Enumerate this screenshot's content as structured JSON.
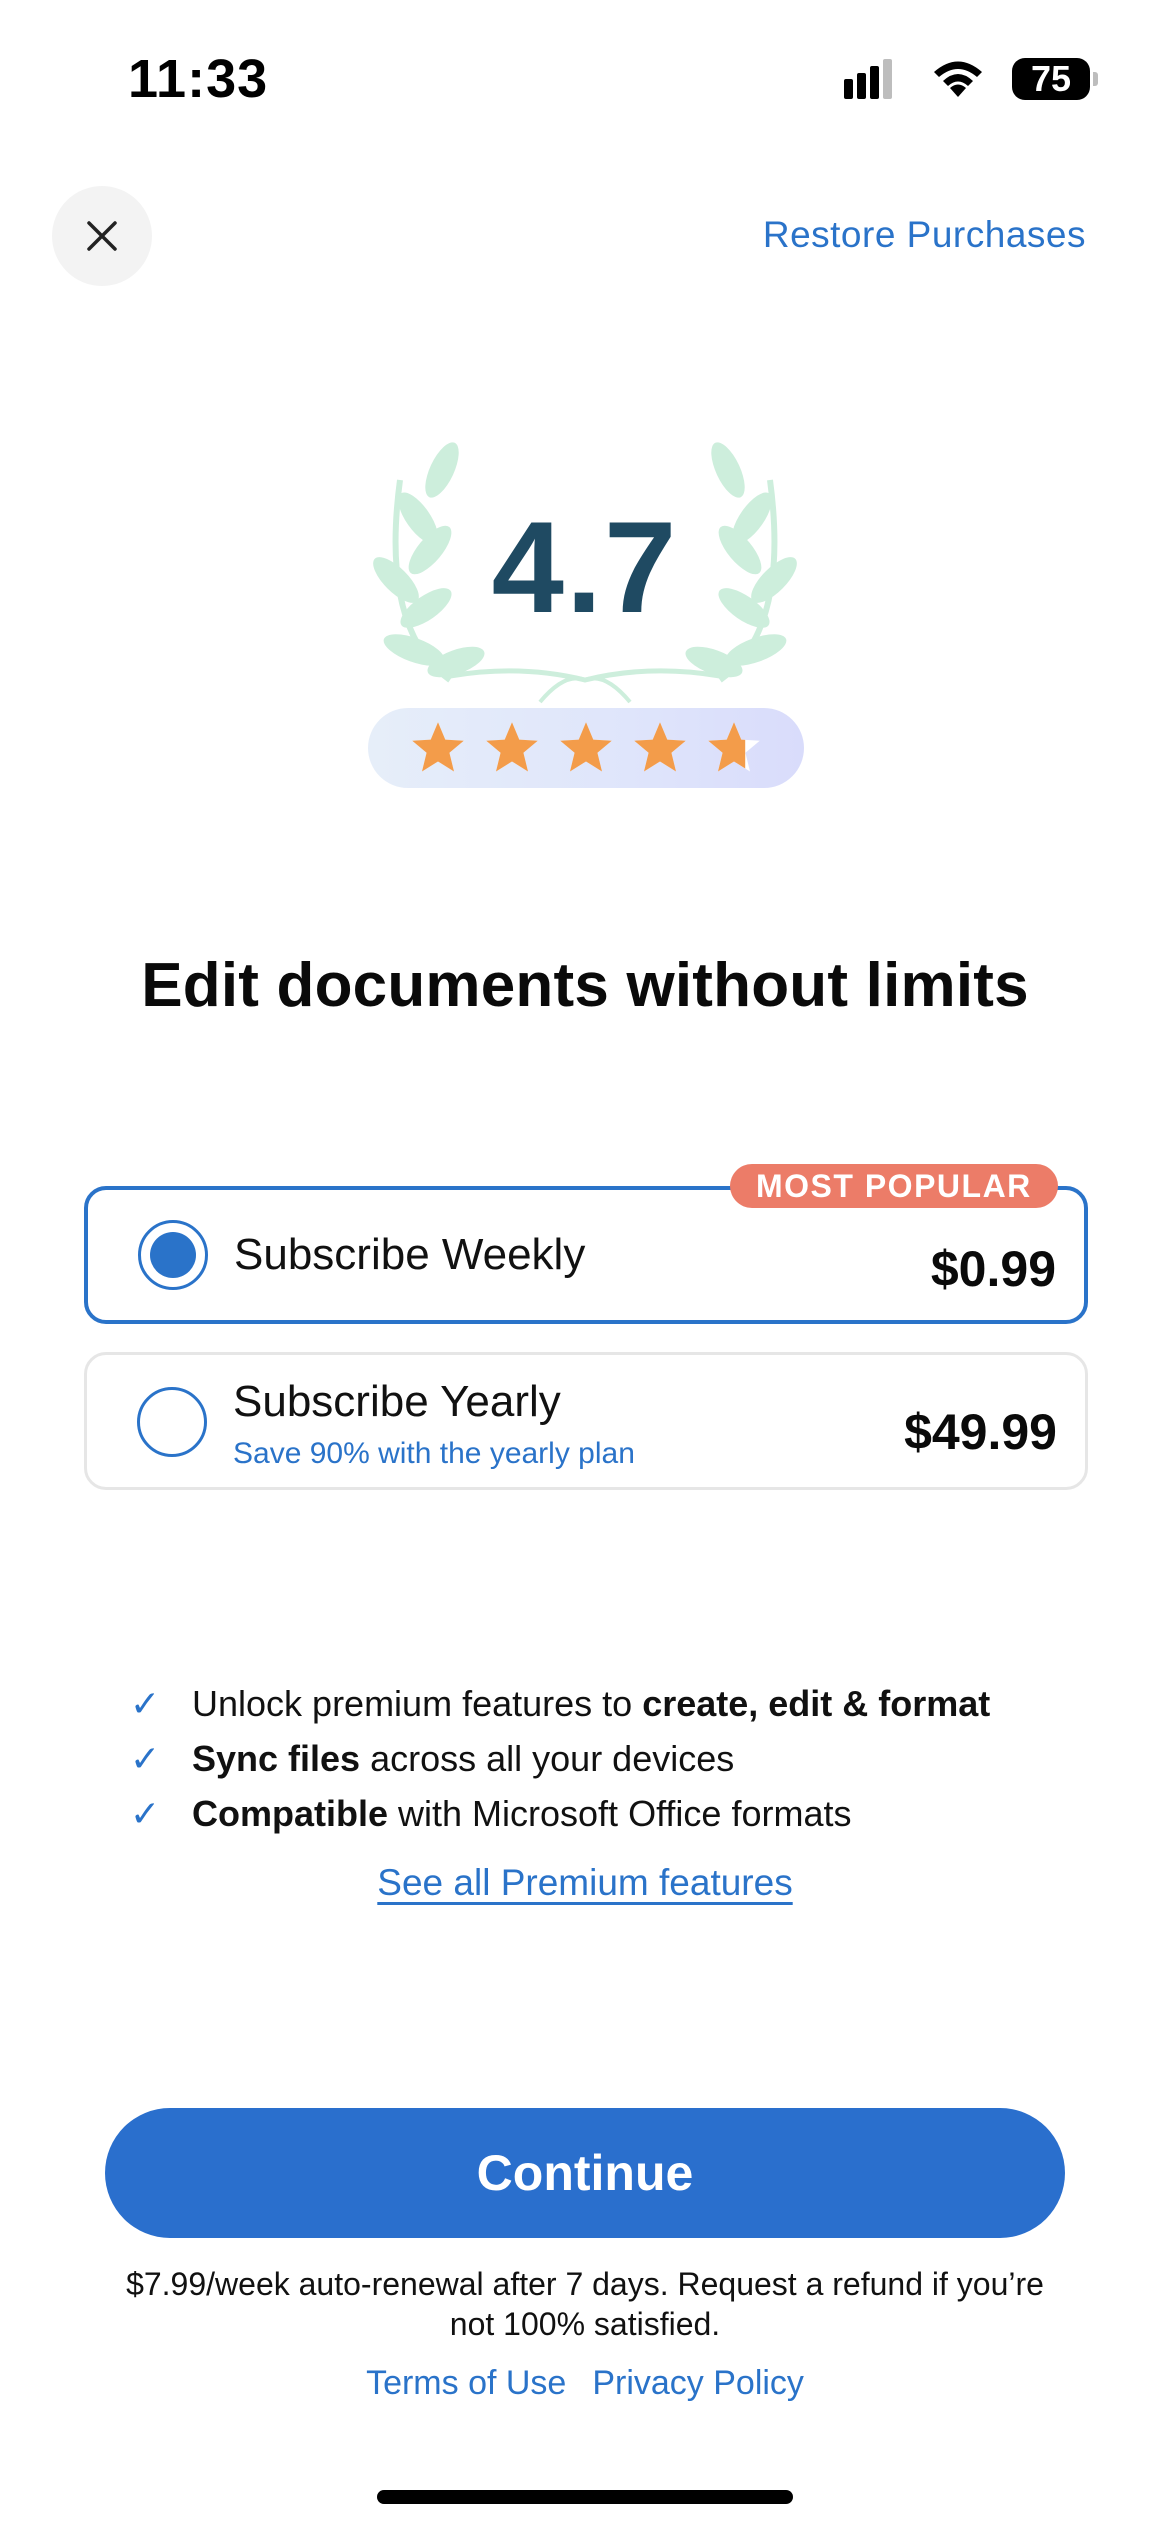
{
  "status_bar": {
    "time": "11:33",
    "battery": "75",
    "icons": [
      "cellular-signal-icon",
      "wifi-icon",
      "battery-icon"
    ]
  },
  "header": {
    "close_icon": "close-icon",
    "restore_label": "Restore Purchases"
  },
  "rating": {
    "value": "4.7",
    "stars": 4.7,
    "star_color": "#f39c4a"
  },
  "headline": "Edit documents without limits",
  "plans": [
    {
      "title": "Subscribe Weekly",
      "price": "$0.99",
      "badge": "MOST POPULAR",
      "selected": true
    },
    {
      "title": "Subscribe Yearly",
      "subtitle": "Save 90% with the yearly plan",
      "price": "$49.99",
      "selected": false
    }
  ],
  "features": [
    {
      "check": "✓",
      "parts": [
        [
          "Unlock premium features to ",
          false
        ],
        [
          "create, edit & format",
          true
        ]
      ]
    },
    {
      "check": "✓",
      "parts": [
        [
          "Sync files",
          true
        ],
        [
          " across all your devices",
          false
        ]
      ]
    },
    {
      "check": "✓",
      "parts": [
        [
          "Compatible",
          true
        ],
        [
          " with Microsoft Office formats",
          false
        ]
      ]
    }
  ],
  "see_all_label": "See all Premium features",
  "continue_label": "Continue",
  "disclaimer": "$7.99/week auto-renewal after 7 days. Request a refund if you’re not 100% satisfied.",
  "links": {
    "terms": "Terms of Use",
    "privacy": "Privacy Policy"
  },
  "colors": {
    "accent": "#2a73c9",
    "badge": "#ec7c68",
    "rating_text": "#1f4a62",
    "laurel": "#cdeedc"
  }
}
